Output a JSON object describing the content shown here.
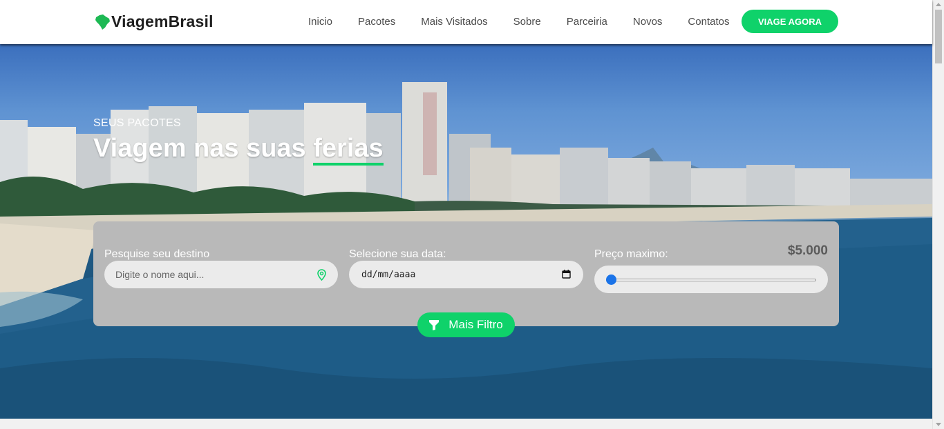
{
  "brand": {
    "name": "ViagemBrasil",
    "logo_icon": "brazil-map-icon",
    "logo_color": "#1db954"
  },
  "nav": {
    "items": [
      {
        "label": "Inicio"
      },
      {
        "label": "Pacotes"
      },
      {
        "label": "Mais Visitados"
      },
      {
        "label": "Sobre"
      },
      {
        "label": "Parceiria"
      },
      {
        "label": "Novos"
      },
      {
        "label": "Contatos"
      }
    ],
    "cta_label": "VIAGE AGORA"
  },
  "hero": {
    "subtitle": "SEUS PACOTES",
    "title_prefix": "Viagem nas suas ",
    "title_highlight": "ferias"
  },
  "search": {
    "destination": {
      "label": "Pesquise seu destino",
      "placeholder": "Digite o nome aqui...",
      "icon": "location-pin-icon"
    },
    "date": {
      "label": "Selecione sua data:",
      "value": "dd/mm/aaaa",
      "icon": "calendar-icon"
    },
    "price": {
      "label": "Preço maximo:",
      "value": "$5.000",
      "slider_level": 0
    },
    "filter_label": "Mais Filtro",
    "filter_icon": "funnel-icon"
  },
  "colors": {
    "accent": "#0fd26a",
    "panel": "#b9b9b9",
    "slider": "#1a73e8"
  }
}
